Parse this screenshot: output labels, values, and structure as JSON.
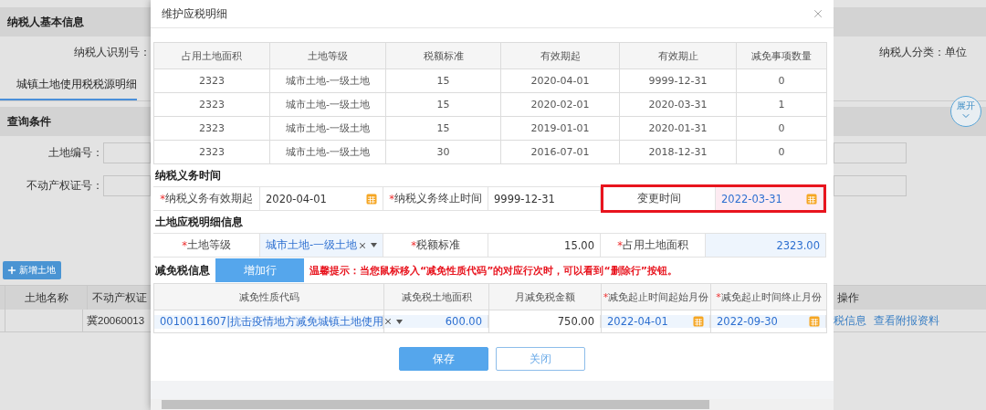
{
  "page": {
    "header": "纳税人基本信息",
    "taxpayer_id_label": "纳税人识别号：",
    "taxpayer_type": "纳税人分类：单位",
    "tab": {
      "label": "城镇土地使用税税源明细",
      "selected": true
    },
    "query_header": "查询条件",
    "expand_button": "展开",
    "fields": [
      {
        "label": "土地编号："
      },
      {
        "label": "不动产权证号："
      }
    ],
    "add_button": "新增土地",
    "table": {
      "columns": [
        "土地名称",
        "不动产权证"
      ],
      "action_column": "操作",
      "rows": [
        {
          "certificate": "冀20060013",
          "actions": [
            "税信息",
            "查看附报资料"
          ]
        }
      ]
    }
  },
  "dialog": {
    "title": "维护应税明细",
    "history": {
      "columns": [
        "占用土地面积",
        "土地等级",
        "税额标准",
        "有效期起",
        "有效期止",
        "减免事项数量"
      ],
      "rows": [
        [
          "2323",
          "城市土地-一级土地",
          "15",
          "2020-04-01",
          "9999-12-31",
          "0"
        ],
        [
          "2323",
          "城市土地-一级土地",
          "15",
          "2020-02-01",
          "2020-03-31",
          "1"
        ],
        [
          "2323",
          "城市土地-一级土地",
          "15",
          "2019-01-01",
          "2020-01-31",
          "0"
        ],
        [
          "2323",
          "城市土地-一级土地",
          "30",
          "2016-07-01",
          "2018-12-31",
          "0"
        ]
      ]
    },
    "obligation": {
      "title": "纳税义务时间",
      "fields": [
        {
          "marker": "*",
          "label": "纳税义务有效期起",
          "value": "2020-04-01",
          "kind": "date",
          "editable": false,
          "highlighted": false
        },
        {
          "marker": "*",
          "label": "纳税义务终止时间",
          "value": "9999-12-31",
          "kind": "text",
          "editable": false,
          "highlighted": false
        },
        {
          "label": "变更时间",
          "value": "2022-03-31",
          "kind": "date",
          "editable": true,
          "highlighted": true
        }
      ]
    },
    "land": {
      "title": "土地应税明细信息",
      "fields": [
        {
          "marker": "*",
          "label": "土地等级",
          "value": "城市土地-一级土地",
          "kind": "select",
          "editable": true
        },
        {
          "marker": "*",
          "label": "税额标准",
          "value": "15.00",
          "kind": "number",
          "editable": false
        },
        {
          "marker": "*",
          "label": "占用土地面积",
          "value": "2323.00",
          "kind": "number",
          "editable": true
        }
      ]
    },
    "relief": {
      "title": "减免税信息",
      "add_row_button": "增加行",
      "tip": "温馨提示：当您鼠标移入“减免性质代码”的对应行次时，可以看到“删除行”按钮。",
      "columns": [
        {
          "label": "减免性质代码"
        },
        {
          "label": "减免税土地面积"
        },
        {
          "label": "月减免税金额"
        },
        {
          "marker": "*",
          "label": "减免起止时间起始月份"
        },
        {
          "marker": "*",
          "label": "减免起止时间终止月份"
        }
      ],
      "rows": [
        {
          "cells": [
            {
              "value": "0010011607|抗击疫情地方减免城镇土地使用",
              "kind": "select",
              "editable": true
            },
            {
              "value": "600.00",
              "kind": "number",
              "editable": true
            },
            {
              "value": "750.00",
              "kind": "number",
              "editable": false
            },
            {
              "value": "2022-04-01",
              "kind": "date",
              "editable": true
            },
            {
              "value": "2022-09-30",
              "kind": "date",
              "editable": true
            }
          ]
        }
      ]
    },
    "buttons": [
      {
        "label": "保存",
        "kind": "primary"
      },
      {
        "label": "关闭",
        "kind": "secondary"
      }
    ]
  }
}
